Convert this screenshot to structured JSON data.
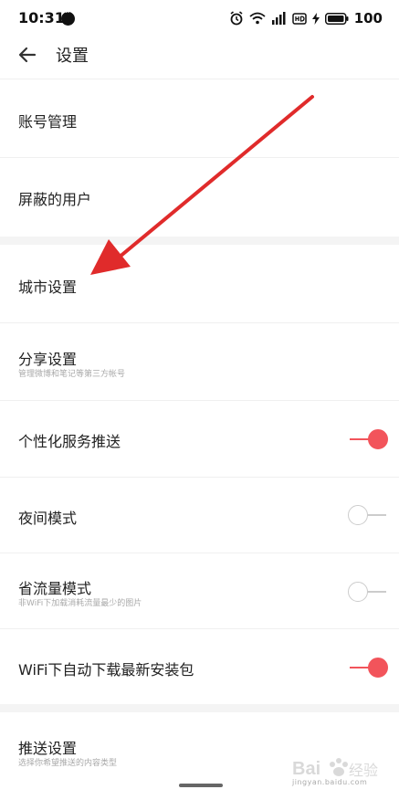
{
  "status_bar": {
    "time": "10:31",
    "battery": "100"
  },
  "header": {
    "title": "设置"
  },
  "settings": {
    "account": {
      "title": "账号管理"
    },
    "blocked": {
      "title": "屏蔽的用户"
    },
    "city": {
      "title": "城市设置"
    },
    "share": {
      "title": "分享设置",
      "subtitle": "管理微博和笔记等第三方帐号"
    },
    "personal_push": {
      "title": "个性化服务推送",
      "enabled": true
    },
    "night_mode": {
      "title": "夜间模式",
      "enabled": false
    },
    "data_saver": {
      "title": "省流量模式",
      "subtitle": "非WiFi下加载消耗流量最少的图片",
      "enabled": false
    },
    "wifi_update": {
      "title": "WiFi下自动下载最新安装包",
      "enabled": true
    },
    "push_settings": {
      "title": "推送设置",
      "subtitle": "选择你希望推送的内容类型"
    }
  },
  "watermark": {
    "text": "Bai经验",
    "url": "jingyan.baidu.com"
  },
  "colors": {
    "accent": "#f2545b",
    "annotation_arrow": "#e02b2b"
  },
  "icons": {
    "back": "arrow-left-icon",
    "alarm": "alarm-icon",
    "wifi": "wifi-icon",
    "signal": "signal-icon",
    "hd": "hd-icon",
    "charging": "charging-icon",
    "battery": "battery-icon",
    "chat": "chat-bubble-icon"
  }
}
